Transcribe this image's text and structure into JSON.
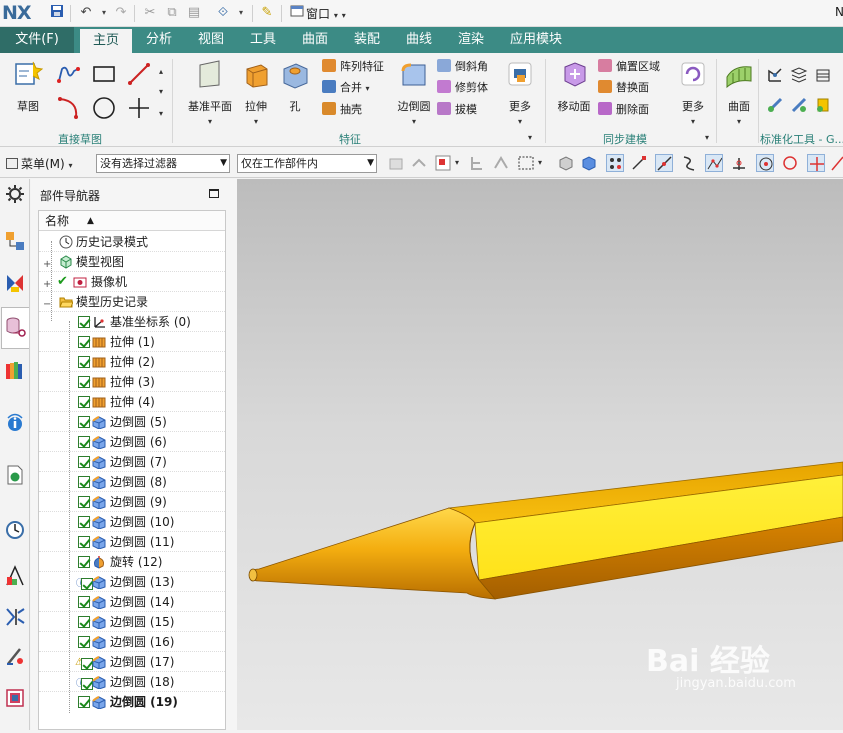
{
  "titlebar": {
    "logo": "NX",
    "window_menu": "窗口",
    "right_letter": "N"
  },
  "tabs": [
    {
      "label": "文件(F)"
    },
    {
      "label": "主页"
    },
    {
      "label": "分析"
    },
    {
      "label": "视图"
    },
    {
      "label": "工具"
    },
    {
      "label": "曲面"
    },
    {
      "label": "装配"
    },
    {
      "label": "曲线"
    },
    {
      "label": "渲染"
    },
    {
      "label": "应用模块"
    }
  ],
  "ribbon": {
    "sketch": {
      "label": "草图",
      "group": "直接草图"
    },
    "feature": {
      "datum_plane": "基准平面",
      "extrude": "拉伸",
      "hole": "孔",
      "pattern_feature": "阵列特征",
      "unite": "合并",
      "shell": "抽壳",
      "edge_blend": "边倒圆",
      "chamfer": "倒斜角",
      "trim_body": "修剪体",
      "draft": "拔模",
      "more": "更多",
      "group": "特征"
    },
    "sync": {
      "move_face": "移动面",
      "offset_region": "偏置区域",
      "replace_face": "替换面",
      "delete_face": "删除面",
      "more": "更多",
      "group": "同步建模"
    },
    "surface": {
      "label": "曲面"
    },
    "standard": {
      "group": "标准化工具 - G..."
    }
  },
  "toolbar2": {
    "menu": "菜单(M)",
    "filter": "没有选择过滤器",
    "scope": "仅在工作部件内"
  },
  "navigator": {
    "title": "部件导航器",
    "column": "名称",
    "nodes": [
      {
        "label": "历史记录模式"
      },
      {
        "label": "模型视图"
      },
      {
        "label": "摄像机"
      },
      {
        "label": "模型历史记录"
      },
      {
        "label": "基准坐标系 (0)"
      },
      {
        "label": "拉伸 (1)"
      },
      {
        "label": "拉伸 (2)"
      },
      {
        "label": "拉伸 (3)"
      },
      {
        "label": "拉伸 (4)"
      },
      {
        "label": "边倒圆 (5)"
      },
      {
        "label": "边倒圆 (6)"
      },
      {
        "label": "边倒圆 (7)"
      },
      {
        "label": "边倒圆 (8)"
      },
      {
        "label": "边倒圆 (9)"
      },
      {
        "label": "边倒圆 (10)"
      },
      {
        "label": "边倒圆 (11)"
      },
      {
        "label": "旋转 (12)"
      },
      {
        "label": "边倒圆 (13)"
      },
      {
        "label": "边倒圆 (14)"
      },
      {
        "label": "边倒圆 (15)"
      },
      {
        "label": "边倒圆 (16)"
      },
      {
        "label": "边倒圆 (17)"
      },
      {
        "label": "边倒圆 (18)"
      },
      {
        "label": "边倒圆 (19)"
      }
    ]
  },
  "watermark": {
    "main": "Bai 经验",
    "sub": "jingyan.baidu.com"
  },
  "colors": {
    "accent": "#3c8b85",
    "pencil": "#f5b800",
    "pencil_light": "#ffe82a"
  }
}
